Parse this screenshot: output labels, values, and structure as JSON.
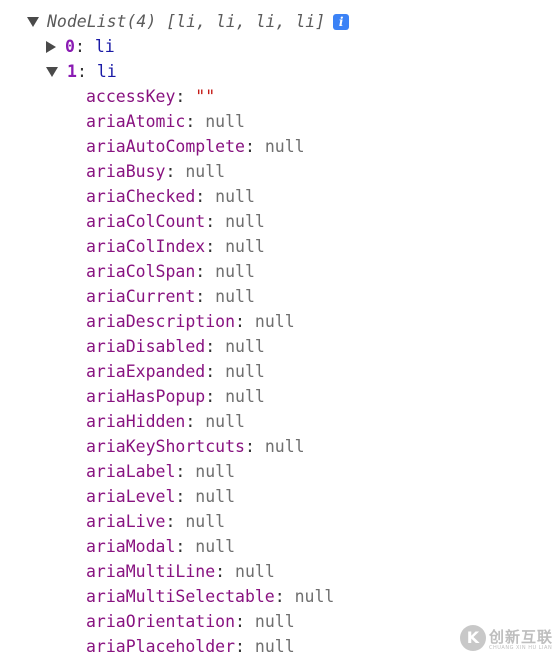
{
  "root": {
    "label": "NodeList(4) [li, li, li, li]",
    "info_icon": "i"
  },
  "items": [
    {
      "index": "0",
      "value": "li",
      "expanded": false
    },
    {
      "index": "1",
      "value": "li",
      "expanded": true
    }
  ],
  "properties": [
    {
      "name": "accessKey",
      "value": "\"\"",
      "type": "string"
    },
    {
      "name": "ariaAtomic",
      "value": "null",
      "type": "null"
    },
    {
      "name": "ariaAutoComplete",
      "value": "null",
      "type": "null"
    },
    {
      "name": "ariaBusy",
      "value": "null",
      "type": "null"
    },
    {
      "name": "ariaChecked",
      "value": "null",
      "type": "null"
    },
    {
      "name": "ariaColCount",
      "value": "null",
      "type": "null"
    },
    {
      "name": "ariaColIndex",
      "value": "null",
      "type": "null"
    },
    {
      "name": "ariaColSpan",
      "value": "null",
      "type": "null"
    },
    {
      "name": "ariaCurrent",
      "value": "null",
      "type": "null"
    },
    {
      "name": "ariaDescription",
      "value": "null",
      "type": "null"
    },
    {
      "name": "ariaDisabled",
      "value": "null",
      "type": "null"
    },
    {
      "name": "ariaExpanded",
      "value": "null",
      "type": "null"
    },
    {
      "name": "ariaHasPopup",
      "value": "null",
      "type": "null"
    },
    {
      "name": "ariaHidden",
      "value": "null",
      "type": "null"
    },
    {
      "name": "ariaKeyShortcuts",
      "value": "null",
      "type": "null"
    },
    {
      "name": "ariaLabel",
      "value": "null",
      "type": "null"
    },
    {
      "name": "ariaLevel",
      "value": "null",
      "type": "null"
    },
    {
      "name": "ariaLive",
      "value": "null",
      "type": "null"
    },
    {
      "name": "ariaModal",
      "value": "null",
      "type": "null"
    },
    {
      "name": "ariaMultiLine",
      "value": "null",
      "type": "null"
    },
    {
      "name": "ariaMultiSelectable",
      "value": "null",
      "type": "null"
    },
    {
      "name": "ariaOrientation",
      "value": "null",
      "type": "null"
    },
    {
      "name": "ariaPlaceholder",
      "value": "null",
      "type": "null"
    }
  ],
  "watermark": {
    "logo_glyph": "K",
    "text": "创新互联",
    "subtext": "CHUANG XIN HU LIAN"
  },
  "colors": {
    "property_name": "#881280",
    "null_value": "#6f6f6f",
    "string_value": "#c41a16",
    "info_badge": "#3b82f6"
  }
}
